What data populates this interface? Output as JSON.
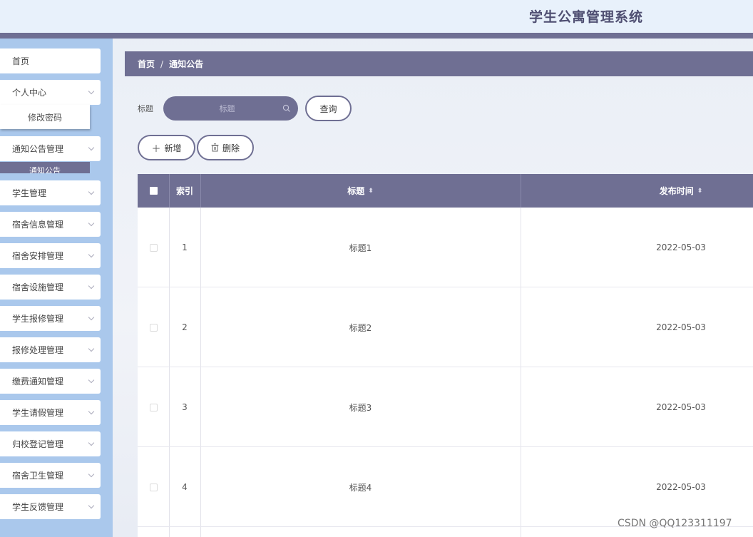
{
  "app": {
    "title": "学生公寓管理系统"
  },
  "sidebar": {
    "items": [
      {
        "label": "首页",
        "has_arrow": false
      },
      {
        "label": "个人中心",
        "has_arrow": true
      },
      {
        "label": "通知公告管理",
        "has_arrow": true
      },
      {
        "label": "学生管理",
        "has_arrow": true
      },
      {
        "label": "宿舍信息管理",
        "has_arrow": true
      },
      {
        "label": "宿舍安排管理",
        "has_arrow": true
      },
      {
        "label": "宿舍设施管理",
        "has_arrow": true
      },
      {
        "label": "学生报修管理",
        "has_arrow": true
      },
      {
        "label": "报修处理管理",
        "has_arrow": true
      },
      {
        "label": "缴费通知管理",
        "has_arrow": true
      },
      {
        "label": "学生请假管理",
        "has_arrow": true
      },
      {
        "label": "归校登记管理",
        "has_arrow": true
      },
      {
        "label": "宿舍卫生管理",
        "has_arrow": true
      },
      {
        "label": "学生反馈管理",
        "has_arrow": true
      }
    ],
    "submenu_password": "修改密码",
    "submenu_notice": "通知公告"
  },
  "breadcrumb": {
    "home": "首页",
    "separator": "/",
    "current": "通知公告"
  },
  "search": {
    "label": "标题",
    "placeholder": "标题",
    "query_button": "查询"
  },
  "actions": {
    "add_button": "新增",
    "delete_button": "删除"
  },
  "table": {
    "headers": {
      "index": "索引",
      "title": "标题",
      "publish_time": "发布时间"
    },
    "rows": [
      {
        "index": "1",
        "title": "标题1",
        "publish_time": "2022-05-03"
      },
      {
        "index": "2",
        "title": "标题2",
        "publish_time": "2022-05-03"
      },
      {
        "index": "3",
        "title": "标题3",
        "publish_time": "2022-05-03"
      },
      {
        "index": "4",
        "title": "标题4",
        "publish_time": "2022-05-03"
      }
    ]
  },
  "watermark": "CSDN @QQ123311197",
  "colors": {
    "accent": "#6f6f93",
    "sidebar_bg": "#aac8ec",
    "header_bg": "#e8f1fb"
  }
}
